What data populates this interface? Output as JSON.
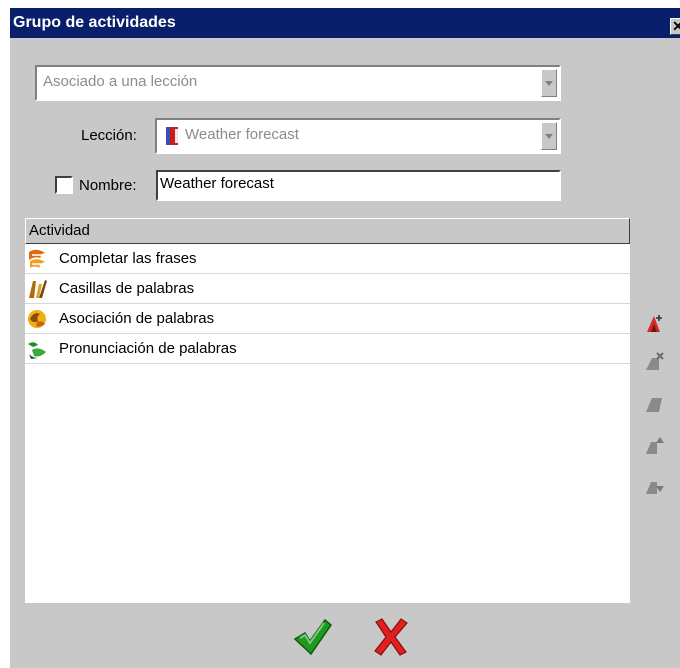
{
  "window": {
    "title": "Grupo de actividades",
    "close_glyph": "✕"
  },
  "association_select": {
    "value": "Asociado a una lección"
  },
  "lesson": {
    "label": "Lección:",
    "value": "Weather forecast"
  },
  "name": {
    "label": "Nombre:",
    "value": "Weather forecast",
    "checked": false
  },
  "activities": {
    "column_header": "Actividad",
    "items": [
      {
        "label": "Completar las frases",
        "icon": "sentence-activity-icon"
      },
      {
        "label": "Casillas de palabras",
        "icon": "word-boxes-activity-icon"
      },
      {
        "label": "Asociación de palabras",
        "icon": "word-association-activity-icon"
      },
      {
        "label": "Pronunciación de palabras",
        "icon": "pronunciation-activity-icon"
      }
    ]
  },
  "side_toolbar": [
    "add-activity-icon",
    "remove-activity-icon",
    "edit-activity-icon",
    "move-up-icon",
    "move-down-icon"
  ],
  "colors": {
    "titlebar": "#0a1f6b",
    "ok": "#1f9a1f",
    "cancel": "#e02020",
    "toolbar_active": "#d12828",
    "toolbar_disabled": "#8a8a8a"
  }
}
